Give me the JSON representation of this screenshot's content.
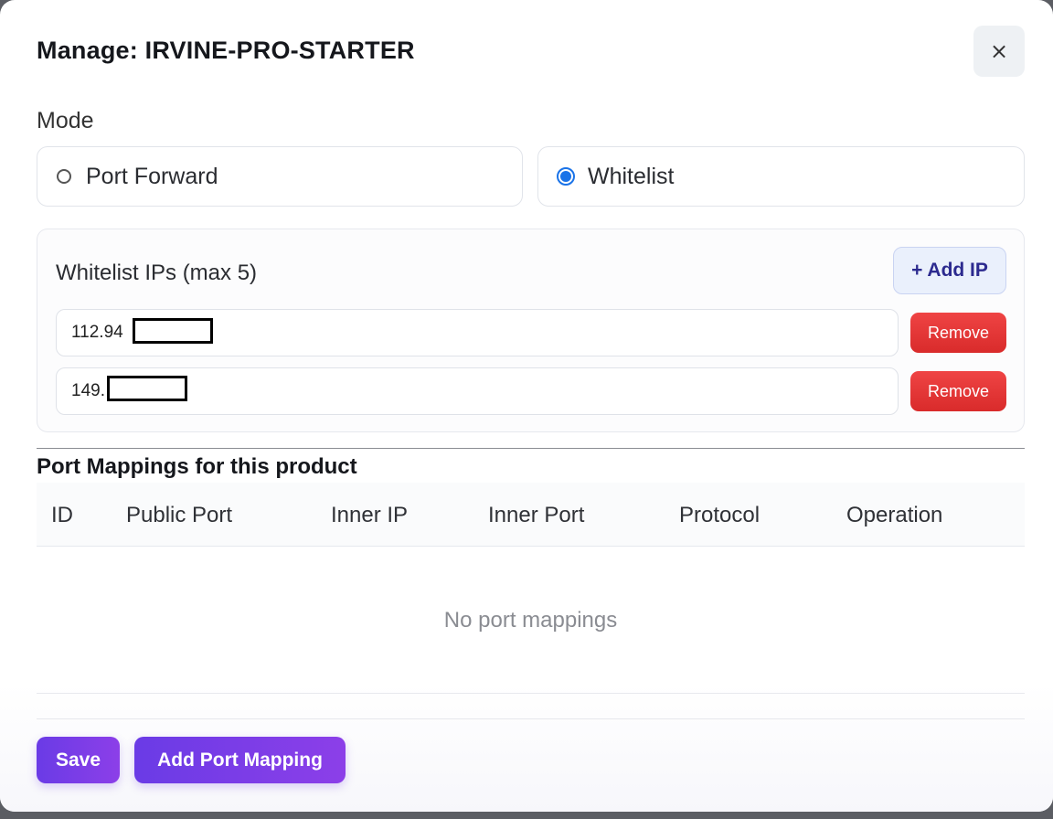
{
  "dialog": {
    "title": "Manage: IRVINE-PRO-STARTER",
    "close_label": "×"
  },
  "mode": {
    "label": "Mode",
    "options": [
      {
        "label": "Port Forward",
        "selected": false
      },
      {
        "label": "Whitelist",
        "selected": true
      }
    ]
  },
  "whitelist": {
    "title": "Whitelist IPs (max 5)",
    "add_label": "+ Add IP",
    "ips": [
      {
        "value": "112.94",
        "remove_label": "Remove"
      },
      {
        "value": "149.",
        "remove_label": "Remove"
      }
    ]
  },
  "port_mappings": {
    "title": "Port Mappings for this product",
    "columns": [
      "ID",
      "Public Port",
      "Inner IP",
      "Inner Port",
      "Protocol",
      "Operation"
    ],
    "empty_text": "No port mappings"
  },
  "footer": {
    "save_label": "Save",
    "add_mapping_label": "Add Port Mapping"
  },
  "colors": {
    "accent": "#7b3ee8",
    "danger": "#e03434",
    "radio_selected": "#1a73e8"
  }
}
